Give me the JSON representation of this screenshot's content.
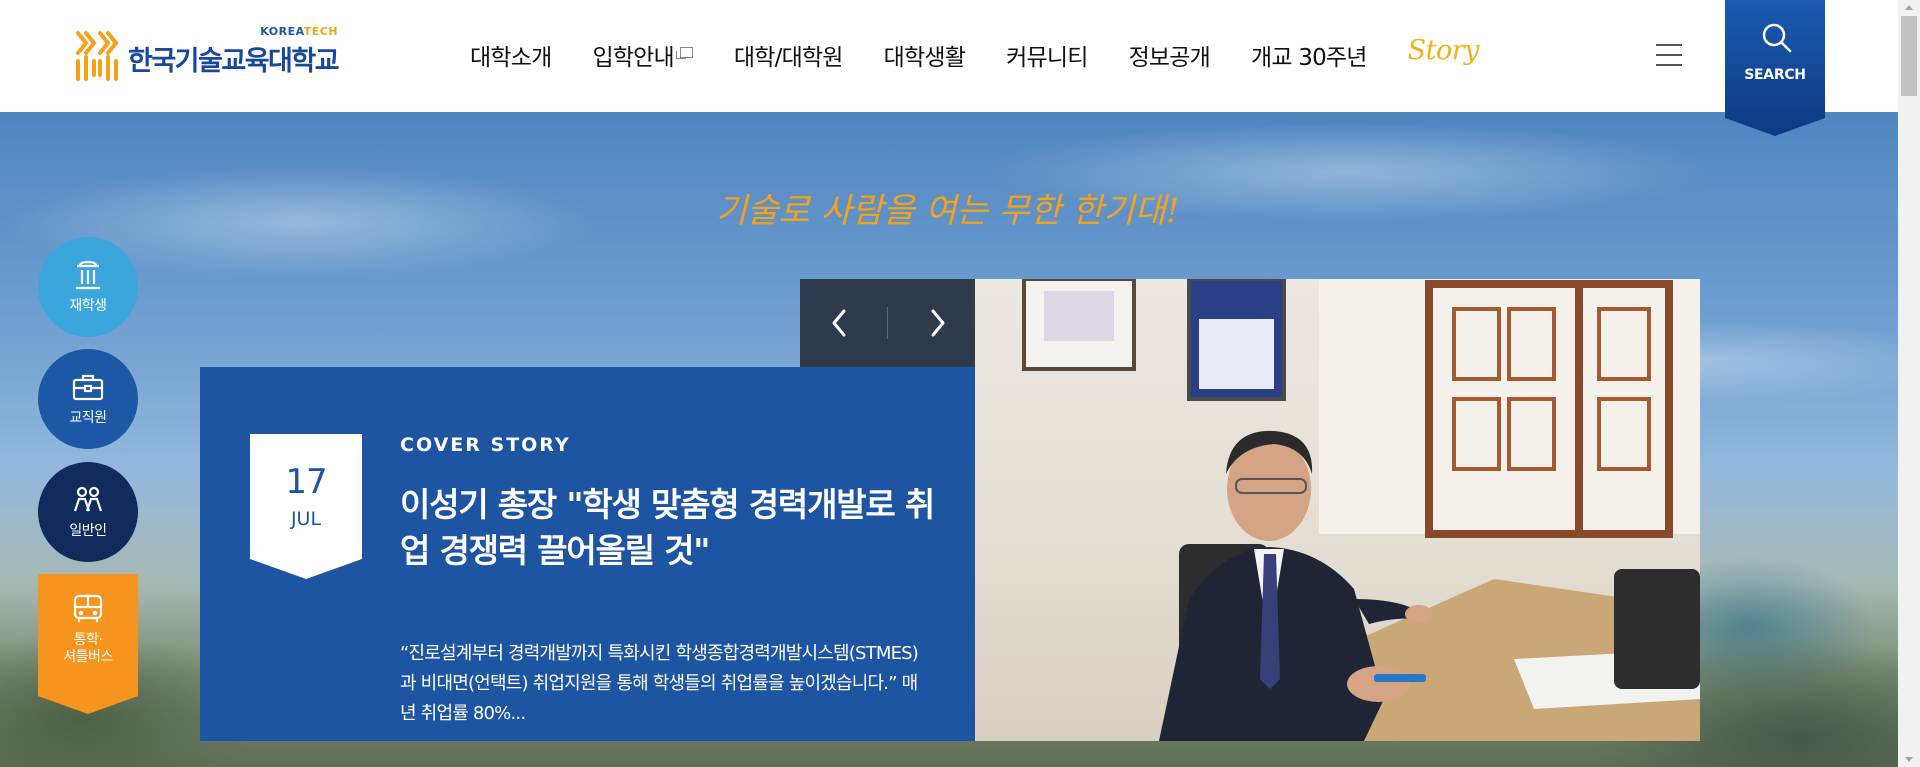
{
  "header": {
    "logo": {
      "name": "한국기술교육대학교",
      "sub_korea": "KOREA",
      "sub_tech": "TECH"
    },
    "nav": [
      {
        "label": "대학소개"
      },
      {
        "label": "입학안내",
        "external": true
      },
      {
        "label": "대학/대학원"
      },
      {
        "label": "대학생활"
      },
      {
        "label": "커뮤니티"
      },
      {
        "label": "정보공개"
      },
      {
        "label": "개교 30주년"
      }
    ],
    "story_label": "Story",
    "search_label": "SEARCH"
  },
  "hero": {
    "slogan": "기술로 사람을 여는 무한 한기대!",
    "quick_menu": [
      {
        "label": "재학생",
        "icon": "student-icon",
        "color": "#3ba6dc"
      },
      {
        "label": "교직원",
        "icon": "briefcase-icon",
        "color": "#1d58a7"
      },
      {
        "label": "일반인",
        "icon": "people-icon",
        "color": "#112c5c"
      },
      {
        "label_line1": "통학·",
        "label_line2": "셔틀버스",
        "icon": "bus-icon",
        "color": "#f7941d"
      }
    ],
    "slide": {
      "day": "17",
      "month": "JUL",
      "category": "COVER STORY",
      "title": "이성기 총장 \"학생 맞춤형 경력개발로 취업 경쟁력 끌어올릴 것\"",
      "description": "“진로설계부터 경력개발까지 특화시킨 학생종합경력개발시스템(STMES)과 비대면(언택트) 취업지원을 통해 학생들의 취업률을 높이겠습니다.” 매년 취업률 80%..."
    }
  },
  "colors": {
    "brand_blue": "#1d55a3",
    "brand_orange": "#f7a21b",
    "navy": "#0f3f8c"
  }
}
